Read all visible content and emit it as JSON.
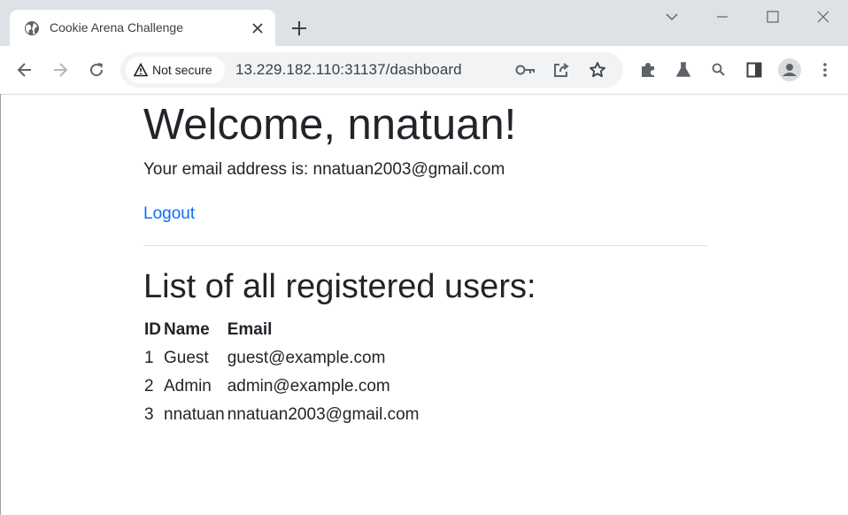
{
  "browser": {
    "tab_title": "Cookie Arena Challenge",
    "security_label": "Not secure",
    "url": "13.229.182.110:31137/dashboard"
  },
  "page": {
    "welcome": "Welcome, nnatuan!",
    "email_line": "Your email address is: nnatuan2003@gmail.com",
    "logout": "Logout",
    "list_title": "List of all registered users:",
    "columns": [
      "ID",
      "Name",
      "Email"
    ],
    "users": [
      {
        "id": "1",
        "name": "Guest",
        "email": "guest@example.com"
      },
      {
        "id": "2",
        "name": "Admin",
        "email": "admin@example.com"
      },
      {
        "id": "3",
        "name": "nnatuan",
        "email": "nnatuan2003@gmail.com"
      }
    ],
    "link_color": "#0d6efd",
    "text_color": "#212529"
  }
}
